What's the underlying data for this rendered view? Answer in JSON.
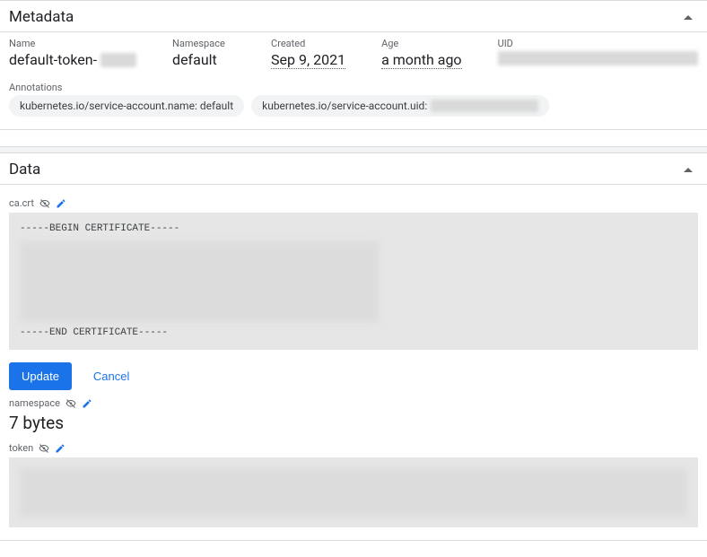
{
  "metadata": {
    "title": "Metadata",
    "fields": {
      "name_label": "Name",
      "name_value": "default-token-",
      "namespace_label": "Namespace",
      "namespace_value": "default",
      "created_label": "Created",
      "created_value": "Sep 9, 2021",
      "age_label": "Age",
      "age_value": "a month ago",
      "uid_label": "UID"
    },
    "annotations_label": "Annotations",
    "annotations": {
      "sa_name": "kubernetes.io/service-account.name: default",
      "sa_uid_prefix": "kubernetes.io/service-account.uid:"
    }
  },
  "data": {
    "title": "Data",
    "cacrt_key": "ca.crt",
    "cert_begin": "-----BEGIN CERTIFICATE-----",
    "cert_end": "-----END CERTIFICATE-----",
    "update_label": "Update",
    "cancel_label": "Cancel",
    "namespace_key": "namespace",
    "namespace_bytes": "7 bytes",
    "token_key": "token"
  }
}
